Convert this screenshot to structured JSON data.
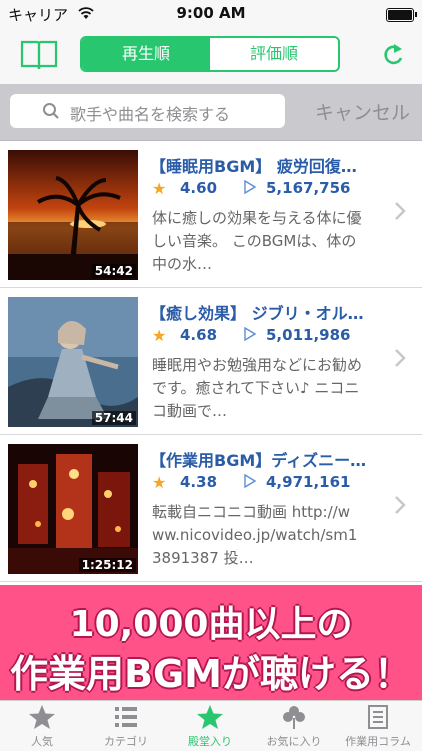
{
  "status_bar": {
    "carrier": "キャリア",
    "time": "9:00 AM"
  },
  "nav": {
    "segments": [
      "再生順",
      "評価順"
    ],
    "selected_segment": "再生順"
  },
  "search": {
    "placeholder": "歌手や曲名を検索する",
    "cancel_label": "キャンセル"
  },
  "videos": [
    {
      "title": "【睡眠用BGM】 疲労回復…",
      "rating": "4.60",
      "views": "5,167,756",
      "description": "体に癒しの効果を与える体に優しい音楽。 このBGMは、体の中の水…",
      "duration": "54:42"
    },
    {
      "title": "【癒し効果】 ジブリ・オル…",
      "rating": "4.68",
      "views": "5,011,986",
      "description": "睡眠用やお勉強用などにお勧めです。癒されて下さい♪ ニコニコ動画で…",
      "duration": "57:44"
    },
    {
      "title": "【作業用BGM】ディズニー…",
      "rating": "4.38",
      "views": "4,971,161",
      "description": "転載自ニコニコ動画 http://www.nicovideo.jp/watch/sm13891387 投…",
      "duration": "1:25:12"
    }
  ],
  "banner": {
    "line1": "10,000曲以上の",
    "line2": "作業用BGMが聴ける！"
  },
  "tabs": [
    {
      "label": "人気",
      "icon": "star-icon"
    },
    {
      "label": "カテゴリ",
      "icon": "category-list-icon"
    },
    {
      "label": "殿堂入り",
      "icon": "hall-of-fame-star-icon",
      "active": true
    },
    {
      "label": "お気に入り",
      "icon": "clover-icon"
    },
    {
      "label": "作業用コラム",
      "icon": "column-icon"
    }
  ],
  "colors": {
    "accent": "#28c76f",
    "title_blue": "#2a5ca8",
    "banner_pink": "#ff5289",
    "star": "#f5a623"
  }
}
